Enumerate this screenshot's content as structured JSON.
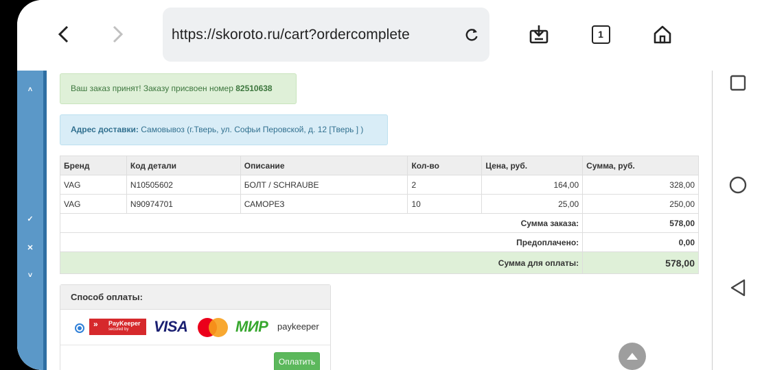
{
  "browser": {
    "url": "https://skoroto.ru/cart?ordercomplete",
    "tab_count": "1"
  },
  "sidebar": {
    "glyphs": [
      "˄",
      "✓",
      "✕",
      "˅"
    ]
  },
  "order": {
    "success_text": "Ваш заказ принят! Заказу присвоен номер",
    "order_number": "82510638",
    "delivery_label": "Адрес доставки:",
    "delivery_value": "Самовывоз (г.Тверь, ул. Софьи Перовской, д. 12 [Тверь ] )"
  },
  "cart": {
    "headers": [
      "Бренд",
      "Код детали",
      "Описание",
      "Кол-во",
      "Цена, руб.",
      "Сумма, руб."
    ],
    "rows": [
      {
        "brand": "VAG",
        "code": "N10505602",
        "desc": "БОЛТ / SCHRAUBE",
        "qty": "2",
        "price": "164,00",
        "sum": "328,00"
      },
      {
        "brand": "VAG",
        "code": "N90974701",
        "desc": "САМОРЕЗ",
        "qty": "10",
        "price": "25,00",
        "sum": "250,00"
      }
    ],
    "order_total_label": "Сумма заказа:",
    "order_total_value": "578,00",
    "prepaid_label": "Предоплачено:",
    "prepaid_value": "0,00",
    "to_pay_label": "Сумма для оплаты:",
    "to_pay_value": "578,00"
  },
  "payment": {
    "title": "Способ оплаты:",
    "paykeeper_badge": "PayKeeper",
    "paykeeper_badge_sub": "secured by",
    "visa": "VISA",
    "mir": "МИР",
    "paykeeper_word": "paykeeper",
    "pay_button": "Оплатить"
  },
  "colors": {
    "success_bg": "#dff0d8",
    "info_bg": "#d9edf7",
    "pay_button": "#5cb85c",
    "sidebar": "#5b98c8"
  }
}
